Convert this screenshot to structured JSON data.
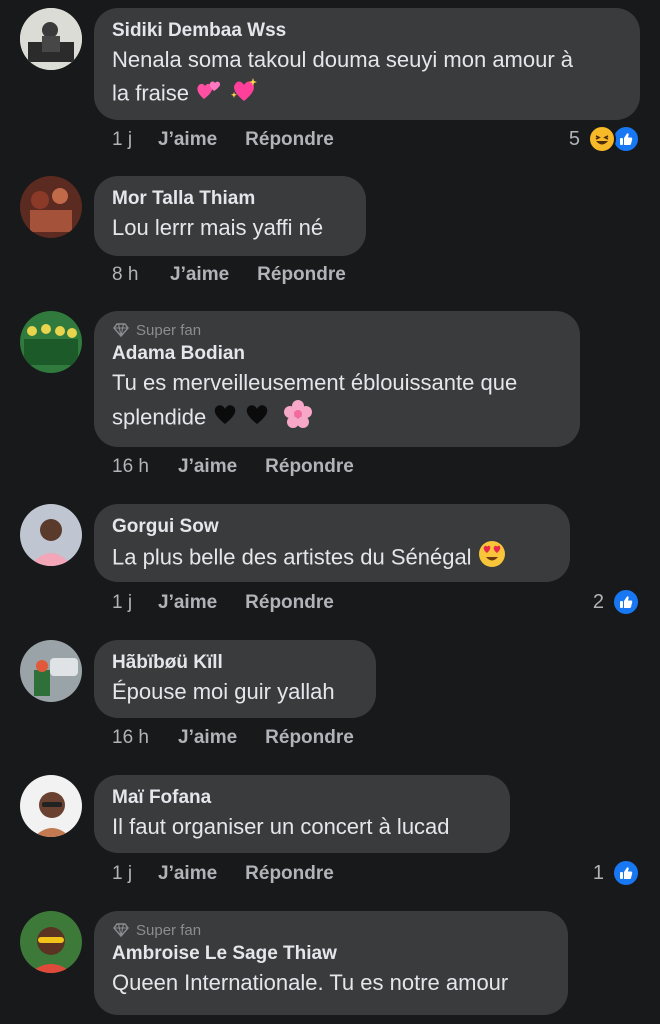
{
  "comments": [
    {
      "author": "Sidiki Dembaa Wss",
      "text_line1": "Nenala soma takoul douma seuyi mon amour à",
      "text_line2": "la fraise",
      "time": "1 j",
      "like_label": "J’aime",
      "reply_label": "Répondre",
      "reaction_count": "5",
      "reactions": [
        "haha-icon",
        "like-icon"
      ]
    },
    {
      "author": "Mor Talla Thiam",
      "text": "Lou lerrr mais yaffi né",
      "time": "8 h",
      "like_label": "J’aime",
      "reply_label": "Répondre"
    },
    {
      "badge": "Super fan",
      "author": "Adama Bodian",
      "text_line1": "Tu es merveilleusement éblouissante que",
      "text_line2": "splendide",
      "time": "16 h",
      "like_label": "J’aime",
      "reply_label": "Répondre"
    },
    {
      "author": "Gorgui Sow",
      "text": "La plus belle des artistes du Sénégal",
      "time": "1 j",
      "like_label": "J’aime",
      "reply_label": "Répondre",
      "reaction_count": "2",
      "reactions": [
        "like-icon"
      ]
    },
    {
      "author": "Hãbïbøü Kïll",
      "text": "Épouse moi guir yallah",
      "time": "16 h",
      "like_label": "J’aime",
      "reply_label": "Répondre"
    },
    {
      "author": "Maï Fofana",
      "text": "Il faut organiser un concert à lucad",
      "time": "1 j",
      "like_label": "J’aime",
      "reply_label": "Répondre",
      "reaction_count": "1",
      "reactions": [
        "like-icon"
      ]
    },
    {
      "badge": "Super fan",
      "author": "Ambroise Le Sage Thiaw",
      "text": "Queen Internationale. Tu es notre amour"
    }
  ],
  "colors": {
    "background": "#18191a",
    "bubble": "#3a3b3c",
    "primary_text": "#e4e6eb",
    "secondary_text": "#b0b3b8",
    "like_blue": "#1877f2"
  }
}
